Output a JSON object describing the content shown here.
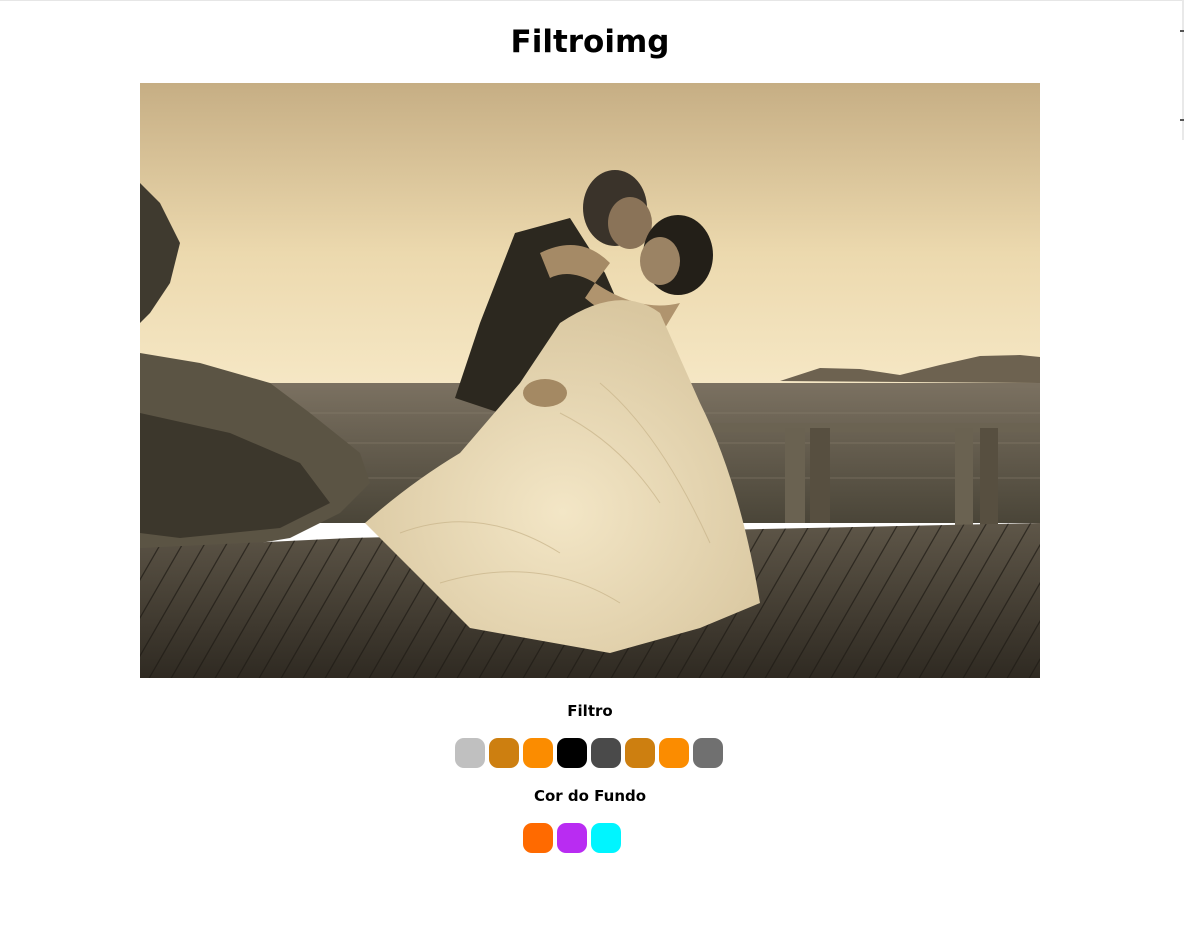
{
  "page": {
    "title": "Filtroimg"
  },
  "image": {
    "description_icon": "wedding-photo",
    "filter_applied": "sepia"
  },
  "filters": {
    "label": "Filtro",
    "swatches": [
      {
        "color": "#c0c0c0"
      },
      {
        "color": "#cd7f10"
      },
      {
        "color": "#fb8c00"
      },
      {
        "color": "#000000"
      },
      {
        "color": "#4a4a4a"
      },
      {
        "color": "#cd7f10"
      },
      {
        "color": "#fb8c00"
      },
      {
        "color": "#707070"
      }
    ]
  },
  "background": {
    "label": "Cor do Fundo",
    "swatches": [
      {
        "color": "#ff6a00"
      },
      {
        "color": "#b92cf2"
      },
      {
        "color": "#00f5ff"
      }
    ]
  }
}
